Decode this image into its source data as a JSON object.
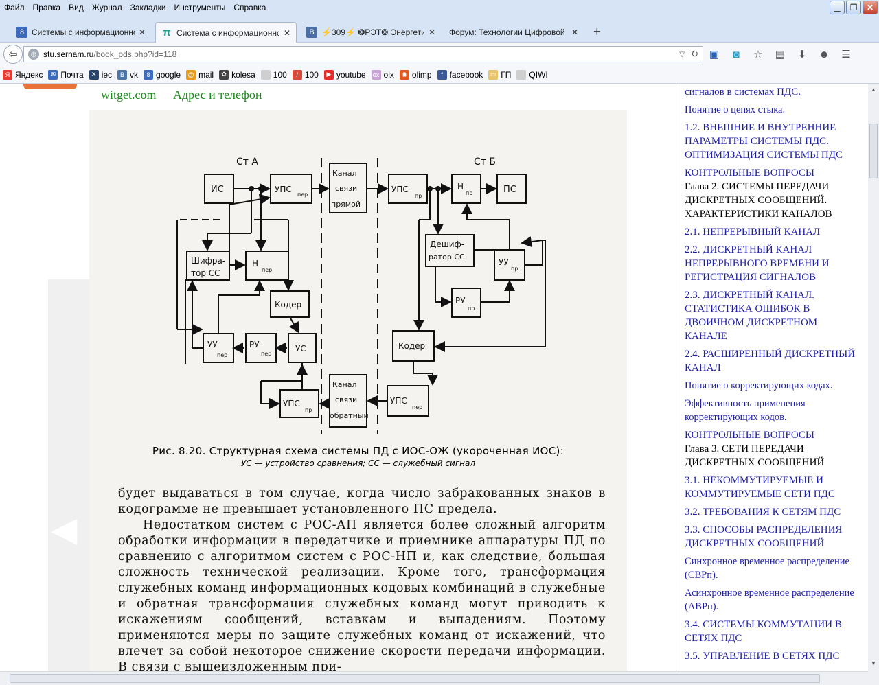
{
  "menu": [
    "Файл",
    "Правка",
    "Вид",
    "Журнал",
    "Закладки",
    "Инструменты",
    "Справка"
  ],
  "tabs": [
    {
      "title": "Системы с информационной...",
      "icon": "8",
      "color": "#3b6bbf"
    },
    {
      "title": "Система с информационной ...",
      "icon": "π",
      "color": "#1c9a8e"
    },
    {
      "title": "⚡309⚡ ❂РЭТ❂ Энергетиче...",
      "icon": "B",
      "color": "#4a6fa5"
    },
    {
      "title": "Форум: Технологии Цифровой С...",
      "icon": "",
      "color": "#d6e4f5"
    }
  ],
  "url": {
    "host": "stu.sernam.ru",
    "path": "/book_pds.php?id=118"
  },
  "bookmarks": [
    {
      "label": "Яндекс",
      "icon": "Я",
      "color": "#e63b2e"
    },
    {
      "label": "Почта",
      "icon": "✉",
      "color": "#3b6bbf"
    },
    {
      "label": "iec",
      "icon": "✕",
      "color": "#28456b"
    },
    {
      "label": "vk",
      "icon": "В",
      "color": "#4a76a8"
    },
    {
      "label": "google",
      "icon": "8",
      "color": "#3b6bbf"
    },
    {
      "label": "mail",
      "icon": "@",
      "color": "#e69a1e"
    },
    {
      "label": "kolesa",
      "icon": "✿",
      "color": "#444"
    },
    {
      "label": "100",
      "icon": "",
      "color": "#cfcfcf"
    },
    {
      "label": "100",
      "icon": "/",
      "color": "#d84a3a"
    },
    {
      "label": "youtube",
      "icon": "▶",
      "color": "#e52d27"
    },
    {
      "label": "olx",
      "icon": "ox",
      "color": "#c9a3d6"
    },
    {
      "label": "olimp",
      "icon": "◉",
      "color": "#e2561d"
    },
    {
      "label": "facebook",
      "icon": "f",
      "color": "#3b5998"
    },
    {
      "label": "ГП",
      "icon": "▭",
      "color": "#e8c46a"
    },
    {
      "label": "QIWI",
      "icon": "",
      "color": "#cfcfcf"
    }
  ],
  "top_links": {
    "site": "witget.com",
    "contacts": "Адрес и телефон"
  },
  "diagram": {
    "station_a": "Ст А",
    "station_b": "Ст Б",
    "blocks": {
      "is": "ИС",
      "ups_a_tx": "УПС",
      "ups_a_tx_sub": "пер",
      "channel_fwd": [
        "Канал",
        "связи",
        "прямой"
      ],
      "ups_b_rx": "УПС",
      "ups_b_rx_sub": "пр",
      "n_b": "Н",
      "n_b_sub": "пр",
      "ps": "ПС",
      "shifrator": [
        "Шифра-",
        "тор СС"
      ],
      "n_a": "Н",
      "n_a_sub": "пер",
      "deshifrator": [
        "Дешиф-",
        "ратор СС"
      ],
      "uu_b": "УУ",
      "uu_b_sub": "пр",
      "coder_a": "Кодер",
      "ru_b": "РУ",
      "ru_b_sub": "пр",
      "uu_a": "УУ",
      "uu_a_sub": "пер",
      "ru_a": "РУ",
      "ru_a_sub": "пер",
      "us": "УС",
      "coder_b": "Кодер",
      "channel_back": [
        "Канал",
        "связи",
        "обратный"
      ],
      "ups_a_rx": "УПС",
      "ups_a_rx_sub": "пр",
      "ups_b_tx": "УПС",
      "ups_b_tx_sub": "пер"
    }
  },
  "caption": {
    "line1": "Рис. 8.20. Структурная схема системы ПД с ИОС-ОЖ (укороченная ИОС):",
    "line2": "УС — устройство сравнения;  СС — служебный сигнал"
  },
  "scan_text": [
    "будет выдаваться в том случае, когда число забракованных знаков в кодограмме не превышает установленного ПС предела.",
    "Недостатком систем с РОС-АП является более сложный алгоритм обработки информации в передатчике и приемнике аппаратуры ПД по сравнению с алгоритмом систем с РОС-НП и, как следствие, большая сложность технической реализации. Кроме того, трансформация служебных команд информационных кодовых комбинаций в служебные и обратная трансформация служебных команд могут приводить к искажениям сообщений, вставкам и выпадениям. Поэтому применяются меры по защите служебных команд от искажений, что влечет за собой некоторое снижение скорости передачи информации. В связи с вышеизложенным при-"
  ],
  "toc": [
    {
      "text": "сигналов в системах ПДС.",
      "link": true
    },
    {
      "text": "Понятие о цепях стыка.",
      "link": true,
      "small": true
    },
    {
      "text": "1.2. ВНЕШНИЕ И ВНУТРЕННИЕ ПАРАМЕТРЫ СИСТЕМЫ ПДС. ОПТИМИЗАЦИЯ СИСТЕМЫ ПДС",
      "link": true
    },
    {
      "text": "КОНТРОЛЬНЫЕ ВОПРОСЫ",
      "link": true,
      "nomb": true
    },
    {
      "text": "Глава 2. СИСТЕМЫ ПЕРЕДАЧИ ДИСКРЕТНЫХ СООБЩЕНИЙ. ХАРАКТЕРИСТИКИ КАНАЛОВ",
      "link": false
    },
    {
      "text": "2.1. НЕПРЕРЫВНЫЙ КАНАЛ",
      "link": true
    },
    {
      "text": "2.2. ДИСКРЕТНЫЙ КАНАЛ НЕПРЕРЫВНОГО ВРЕМЕНИ И РЕГИСТРАЦИЯ СИГНАЛОВ",
      "link": true
    },
    {
      "text": "2.3. ДИСКРЕТНЫЙ КАНАЛ. СТАТИСТИКА ОШИБОК В ДВОИЧНОМ ДИСКРЕТНОМ КАНАЛЕ",
      "link": true
    },
    {
      "text": "2.4. РАСШИРЕННЫЙ ДИСКРЕТНЫЙ КАНАЛ",
      "link": true
    },
    {
      "text": "Понятие о корректирующих кодах.",
      "link": true,
      "small": true
    },
    {
      "text": "Эффективность применения корректирующих кодов.",
      "link": true,
      "small": true
    },
    {
      "text": "КОНТРОЛЬНЫЕ ВОПРОСЫ",
      "link": true,
      "nomb": true
    },
    {
      "text": "Глава 3. СЕТИ ПЕРЕДАЧИ ДИСКРЕТНЫХ СООБЩЕНИЙ",
      "link": false
    },
    {
      "text": "3.1. НЕКОММУТИРУЕМЫЕ И КОММУТИРУЕМЫЕ СЕТИ ПДС",
      "link": true
    },
    {
      "text": "3.2. ТРЕБОВАНИЯ К СЕТЯМ ПДС",
      "link": true
    },
    {
      "text": "3.3. СПОСОБЫ РАСПРЕДЕЛЕНИЯ ДИСКРЕТНЫХ СООБЩЕНИЙ",
      "link": true
    },
    {
      "text": "Синхронное временное распределение (СВРп).",
      "link": true,
      "small": true
    },
    {
      "text": "Асинхронное временное распределение (АВРп).",
      "link": true,
      "small": true
    },
    {
      "text": "3.4. СИСТЕМЫ КОММУТАЦИИ В СЕТЯХ ПДС",
      "link": true
    },
    {
      "text": "3.5. УПРАВЛЕНИЕ В СЕТЯХ ПДС",
      "link": true
    }
  ]
}
